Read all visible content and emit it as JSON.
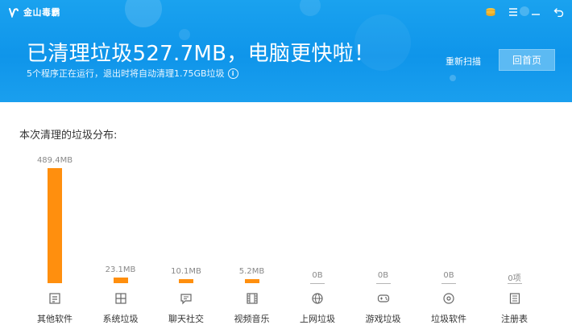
{
  "app": {
    "logo_text": "金山毒霸"
  },
  "header": {
    "headline": "已清理垃圾527.7MB，电脑更快啦！",
    "subline": "5个程序正在运行，退出时将自动清理1.75GB垃圾",
    "info_icon": "i",
    "rescan_label": "重新扫描",
    "home_label": "回首页"
  },
  "icons": [
    "kingsoft-logo-icon",
    "coins-icon",
    "menu-icon",
    "minimize-icon",
    "back-icon"
  ],
  "colors": {
    "header_blue": "#1a9fee",
    "bar_orange": "#ff8f0e",
    "home_button": "#5cbaf3"
  },
  "section_title": "本次清理的垃圾分布:",
  "chart_data": {
    "type": "bar",
    "categories": [
      "其他软件",
      "系统垃圾",
      "聊天社交",
      "视频音乐",
      "上网垃圾",
      "游戏垃圾",
      "垃圾软件",
      "注册表"
    ],
    "values": [
      489.4,
      23.1,
      10.1,
      5.2,
      0,
      0,
      0,
      0
    ],
    "units": [
      "MB",
      "MB",
      "MB",
      "MB",
      "MB",
      "MB",
      "MB",
      "项"
    ],
    "value_labels": [
      "489.4MB",
      "23.1MB",
      "10.1MB",
      "5.2MB",
      "0B",
      "0B",
      "0B",
      "0项"
    ],
    "category_icons": [
      "document-icon",
      "windows-icon",
      "chat-icon",
      "film-icon",
      "globe-icon",
      "gamepad-icon",
      "disc-icon",
      "registry-icon"
    ],
    "title": "本次清理的垃圾分布:",
    "xlabel": "",
    "ylabel": "",
    "ylim": [
      0,
      489.4
    ],
    "grid": false,
    "legend": "none"
  }
}
